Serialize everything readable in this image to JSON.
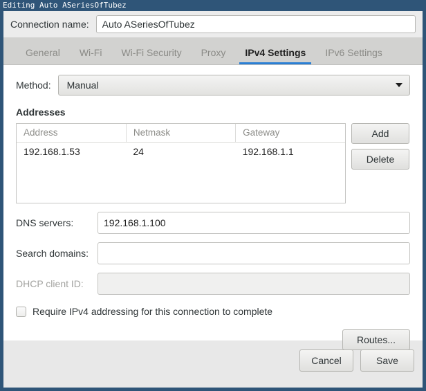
{
  "window": {
    "title": "Editing Auto ASeriesOfTubez"
  },
  "connection": {
    "label": "Connection name:",
    "value": "Auto ASeriesOfTubez"
  },
  "tabs": [
    {
      "label": "General",
      "active": false
    },
    {
      "label": "Wi-Fi",
      "active": false
    },
    {
      "label": "Wi-Fi Security",
      "active": false
    },
    {
      "label": "Proxy",
      "active": false
    },
    {
      "label": "IPv4 Settings",
      "active": true
    },
    {
      "label": "IPv6 Settings",
      "active": false
    }
  ],
  "method": {
    "label": "Method:",
    "value": "Manual",
    "caret_icon": "chevron-down-icon"
  },
  "addresses": {
    "section_title": "Addresses",
    "columns": [
      "Address",
      "Netmask",
      "Gateway"
    ],
    "rows": [
      {
        "address": "192.168.1.53",
        "netmask": "24",
        "gateway": "192.168.1.1"
      }
    ],
    "add_label": "Add",
    "delete_label": "Delete"
  },
  "dns": {
    "label": "DNS servers:",
    "value": "192.168.1.100"
  },
  "search_domains": {
    "label": "Search domains:",
    "value": "",
    "placeholder": ""
  },
  "dhcp": {
    "label": "DHCP client ID:",
    "value": "",
    "placeholder": "",
    "disabled": true
  },
  "require_ipv4": {
    "label": "Require IPv4 addressing for this connection to complete",
    "checked": false
  },
  "routes": {
    "label": "Routes..."
  },
  "footer": {
    "cancel_label": "Cancel",
    "save_label": "Save"
  },
  "colors": {
    "titlebar": "#2f5578",
    "accent": "#2a7fd4",
    "tabstrip": "#d2d2d0",
    "content": "#ffffff",
    "chrome": "#e8e8e8"
  }
}
